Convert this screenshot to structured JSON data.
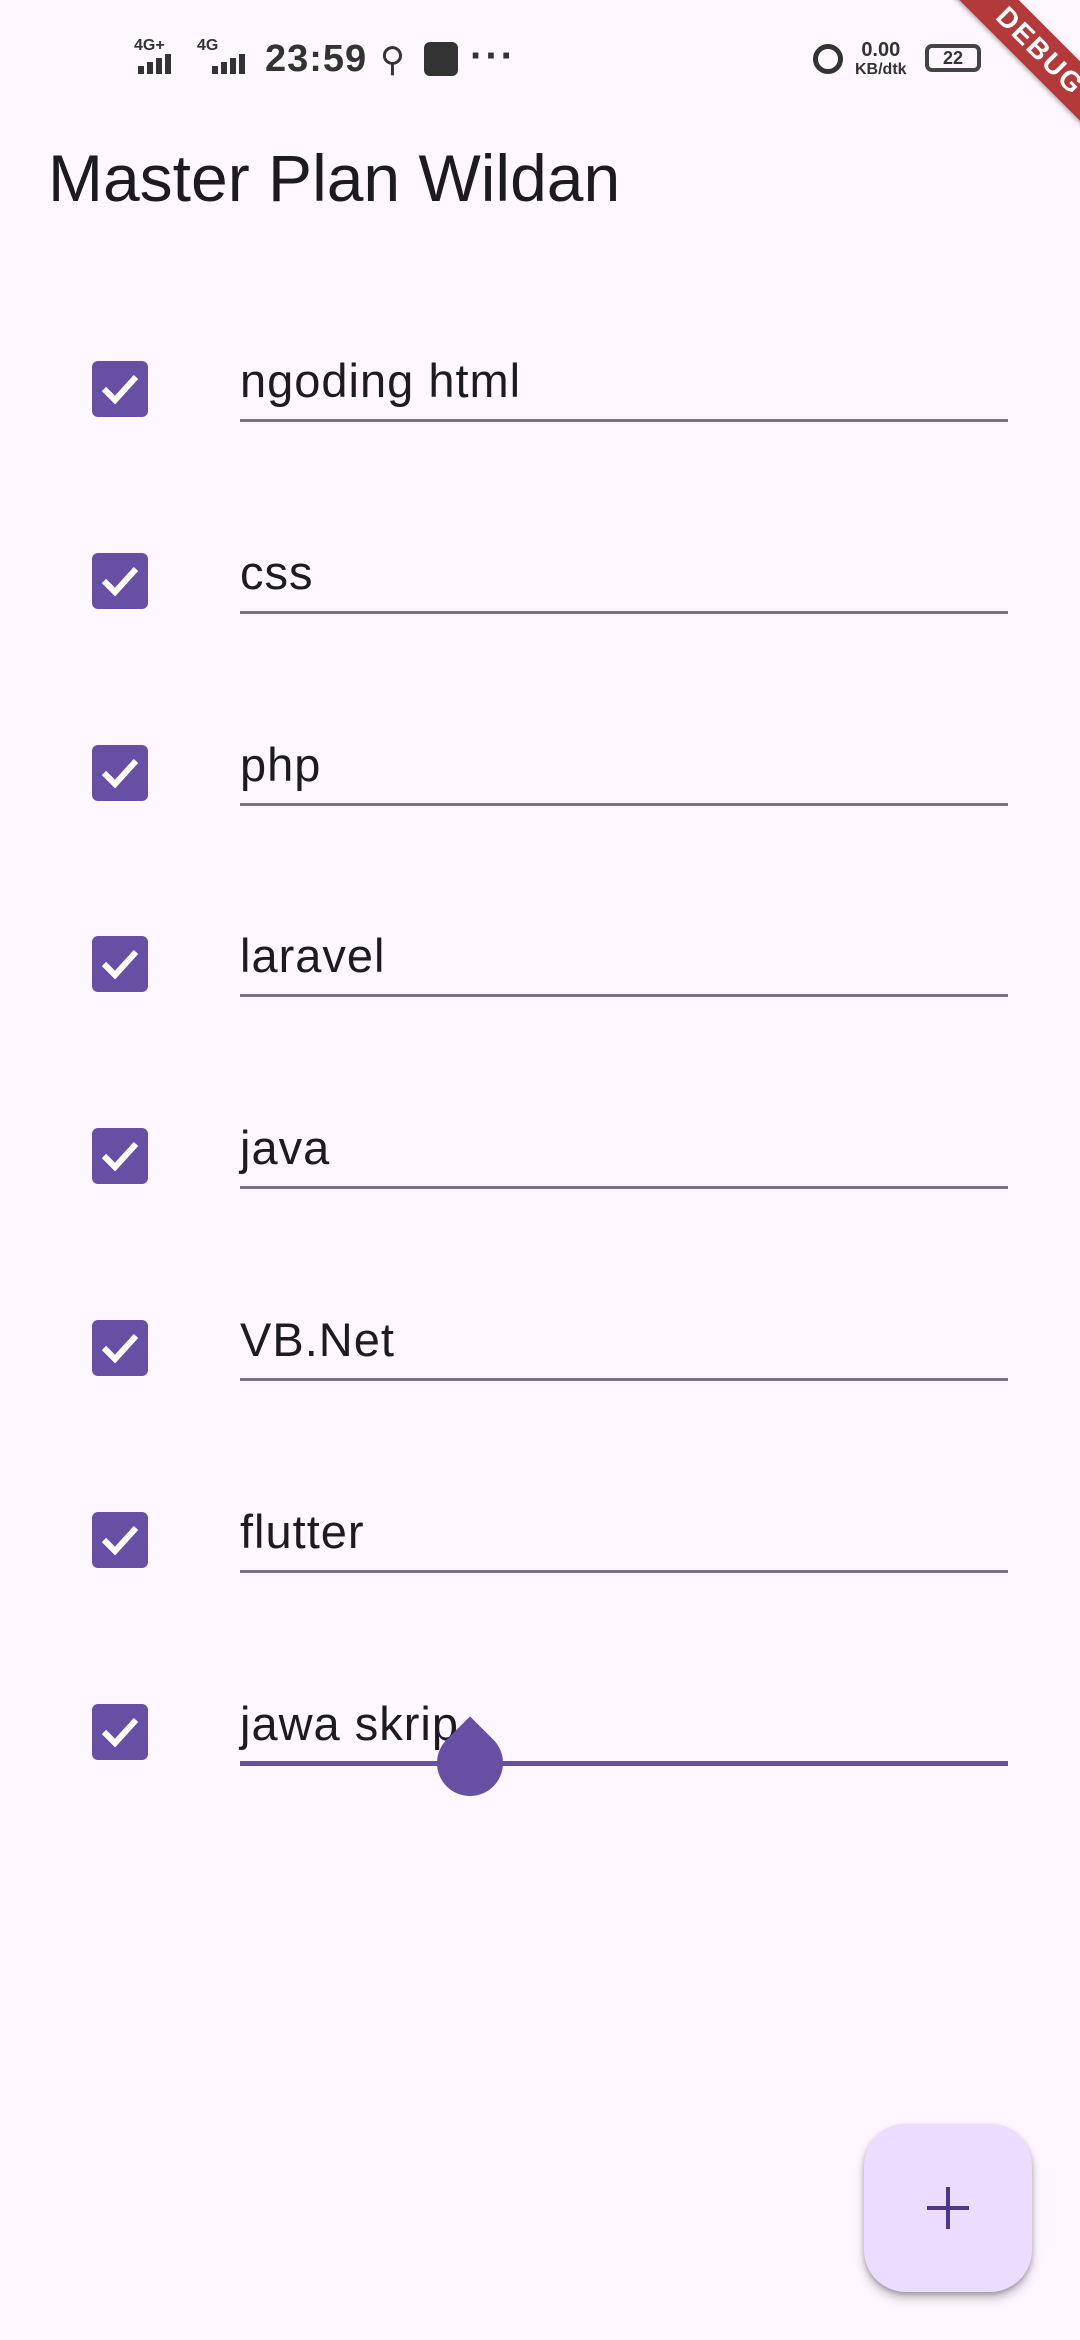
{
  "status_bar": {
    "network_1": "4G+",
    "network_2": "4G",
    "time": "23:59",
    "more": "···",
    "speed_value": "0.00",
    "speed_unit": "KB/dtk",
    "battery": "22"
  },
  "debug_banner": "DEBUG",
  "app_bar": {
    "title": "Master Plan Wildan"
  },
  "tasks": [
    {
      "text": "ngoding html",
      "checked": true
    },
    {
      "text": "css",
      "checked": true
    },
    {
      "text": "php",
      "checked": true
    },
    {
      "text": "laravel",
      "checked": true
    },
    {
      "text": "java",
      "checked": true
    },
    {
      "text": "VB.Net",
      "checked": true
    },
    {
      "text": "flutter",
      "checked": true
    },
    {
      "text": "jawa skrip",
      "checked": true
    }
  ],
  "colors": {
    "primary": "#6750A4",
    "background": "#FEF7FF",
    "fab": "#EADDFF",
    "debug": "#B33A3A"
  },
  "fab": {
    "icon": "plus-icon"
  }
}
